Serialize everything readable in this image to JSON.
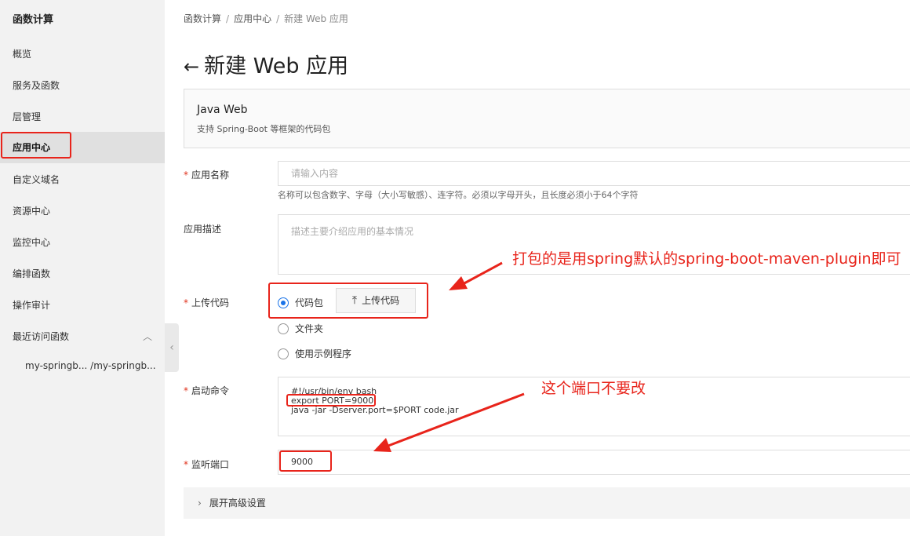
{
  "sidebar": {
    "title": "函数计算",
    "items": [
      {
        "label": "概览"
      },
      {
        "label": "服务及函数"
      },
      {
        "label": "层管理"
      },
      {
        "label": "应用中心"
      },
      {
        "label": "自定义域名"
      },
      {
        "label": "资源中心"
      },
      {
        "label": "监控中心"
      },
      {
        "label": "编排函数"
      },
      {
        "label": "操作审计"
      },
      {
        "label": "最近访问函数"
      }
    ],
    "active_item": "应用中心",
    "recent_function": "my-springb... /my-springb...",
    "collapse_icon": "chevron-left-icon"
  },
  "breadcrumb": {
    "items": [
      "函数计算",
      "应用中心",
      "新建 Web 应用"
    ],
    "separator": "/"
  },
  "page": {
    "title": "新建 Web 应用",
    "back_icon": "arrow-left-icon"
  },
  "runtime": {
    "name": "Java Web",
    "description": "支持 Spring-Boot 等框架的代码包"
  },
  "form": {
    "app_name": {
      "label": "应用名称",
      "required": true,
      "value": "",
      "placeholder": "请输入内容",
      "hint": "名称可以包含数字、字母（大小写敏感）、连字符。必须以字母开头，且长度必须小于64个字符"
    },
    "app_desc": {
      "label": "应用描述",
      "required": false,
      "value": "",
      "placeholder": "描述主要介绍应用的基本情况"
    },
    "upload": {
      "label": "上传代码",
      "required": true,
      "options": [
        {
          "label": "代码包",
          "checked": true
        },
        {
          "label": "文件夹",
          "checked": false
        },
        {
          "label": "使用示例程序",
          "checked": false
        }
      ],
      "upload_button": "上传代码",
      "upload_icon": "upload-icon"
    },
    "start_command": {
      "label": "启动命令",
      "required": true,
      "lines": [
        "#!/usr/bin/env bash",
        "export PORT=9000",
        "java -jar -Dserver.port=$PORT code.jar"
      ]
    },
    "listen_port": {
      "label": "监听端口",
      "required": true,
      "value": "9000"
    },
    "advanced": {
      "label": "展开高级设置"
    }
  },
  "annotations": {
    "note1": "打包的是用spring默认的spring-boot-maven-plugin即可",
    "note2": "这个端口不要改",
    "color": "#e8241b"
  }
}
